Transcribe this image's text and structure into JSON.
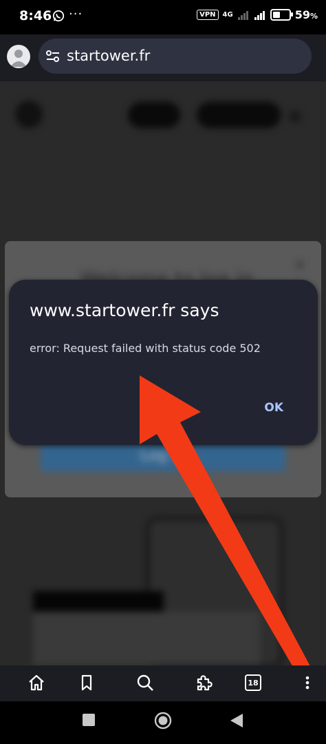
{
  "status_bar": {
    "time": "8:46",
    "vpn_label": "VPN",
    "network_label": "4G",
    "battery_percent": "59",
    "battery_suffix": "%",
    "battery_level": 0.59
  },
  "browser": {
    "url": "startower.fr",
    "tab_count": "18"
  },
  "background_page": {
    "welcome_text": "Welcome to log in",
    "login_button_label": "Log in",
    "close_glyph": "×"
  },
  "dialog": {
    "title": "www.startower.fr says",
    "message": "error:  Request failed with status code 502",
    "ok_label": "OK"
  },
  "colors": {
    "annotation_arrow": "#f23a16",
    "dialog_bg": "#222531",
    "dialog_button": "#a9c6ff"
  },
  "icons": {
    "bottom_bar": [
      "home-icon",
      "bookmark-icon",
      "search-icon",
      "extensions-icon",
      "tabs-icon",
      "more-icon"
    ],
    "nav_bar": [
      "recents-icon",
      "home-nav-icon",
      "back-icon"
    ]
  }
}
